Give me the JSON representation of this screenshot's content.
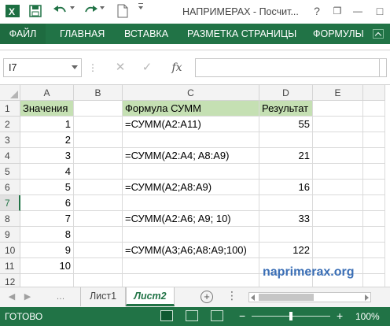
{
  "title_bar": {
    "title": "НАПРИМЕРАХ - Посчит...",
    "app_icon": "excel-icon",
    "save_icon": "save-icon",
    "undo_icon": "undo-icon",
    "redo_icon": "redo-icon",
    "file_icon": "new-file-icon"
  },
  "window_controls": {
    "help": "?",
    "restore": "❐",
    "minimize": "—",
    "maximize": "□",
    "close": "✕"
  },
  "ribbon_tabs": [
    "ФАЙЛ",
    "ГЛАВНАЯ",
    "ВСТАВКА",
    "РАЗМЕТКА СТРАНИЦЫ",
    "ФОРМУЛЫ"
  ],
  "formula_bar": {
    "name_box": "I7",
    "cancel_glyph": "✕",
    "enter_glyph": "✓",
    "fx_label": "fx",
    "formula": ""
  },
  "columns": [
    "A",
    "B",
    "C",
    "D",
    "E"
  ],
  "rows": [
    "1",
    "2",
    "3",
    "4",
    "5",
    "6",
    "7",
    "8",
    "9",
    "10",
    "11",
    "12"
  ],
  "selected_row": "7",
  "cells": {
    "A1": "Значения",
    "A2": "1",
    "A3": "2",
    "A4": "3",
    "A5": "4",
    "A6": "5",
    "A7": "6",
    "A8": "7",
    "A9": "8",
    "A10": "9",
    "A11": "10",
    "C1": "Формула СУММ",
    "C2": "=СУММ(A2:A11)",
    "C4": "=СУММ(A2:A4; A8:A9)",
    "C6": "=СУММ(A2;A8:A9)",
    "C8": "=СУММ(A2:A6; A9; 10)",
    "C10": "=СУММ(A3;A6;A8:A9;100)",
    "D1": "Результат",
    "D2": "55",
    "D4": "21",
    "D6": "16",
    "D8": "33",
    "D10": "122"
  },
  "highlight_color": "#c5e0b3",
  "accent_color": "#217346",
  "watermark": "naprimerax.org",
  "sheets": [
    "Лист1",
    "Лист2"
  ],
  "active_sheet": "Лист2",
  "status": {
    "ready": "ГОТОВО",
    "zoom_minus": "−",
    "zoom_plus": "+",
    "zoom": "100%"
  }
}
